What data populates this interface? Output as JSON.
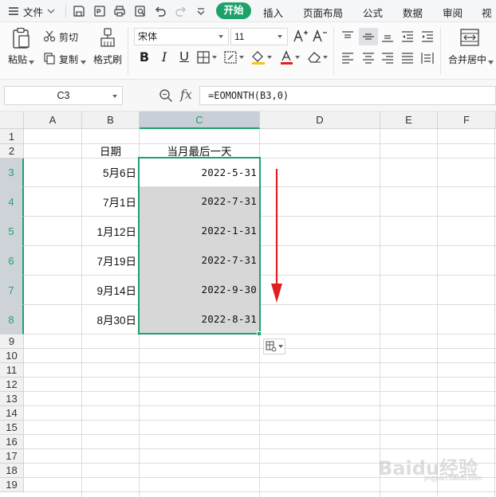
{
  "menubar": {
    "file_label": "文件",
    "tabs": [
      "开始",
      "插入",
      "页面布局",
      "公式",
      "数据",
      "审阅",
      "视图"
    ]
  },
  "ribbon": {
    "paste_label": "粘贴",
    "cut_label": "剪切",
    "copy_label": "复制",
    "format_painter_label": "格式刷",
    "font_name": "宋体",
    "font_size": "11",
    "merge_center_label": "合并居中"
  },
  "formula_bar": {
    "cell_ref": "C3",
    "fx_label": "fx",
    "formula": "=EOMONTH(B3,0)"
  },
  "grid": {
    "columns": [
      "A",
      "B",
      "C",
      "D",
      "E",
      "F"
    ],
    "rows": [
      "1",
      "2",
      "3",
      "4",
      "5",
      "6",
      "7",
      "8",
      "9",
      "10",
      "11",
      "12",
      "13",
      "14",
      "15",
      "16",
      "17",
      "18",
      "19"
    ],
    "header_b2": "日期",
    "header_c2": "当月最后一天",
    "dates": [
      "5月6日",
      "7月1日",
      "1月12日",
      "7月19日",
      "9月14日",
      "8月30日"
    ],
    "month_ends": [
      "2022-5-31",
      "2022-7-31",
      "2022-1-31",
      "2022-7-31",
      "2022-9-30",
      "2022-8-31"
    ]
  },
  "watermark": {
    "text": "Baidu经验",
    "sub": "jingyan.baidu.com"
  },
  "colors": {
    "accent": "#1ea26a",
    "arrow": "#e02020",
    "selection_fill": "#d7d7d7"
  },
  "icons": [
    "menu-icon",
    "save-icon",
    "export-pdf-icon",
    "print-icon",
    "print-preview-icon",
    "undo-icon",
    "redo-icon",
    "paste-icon",
    "cut-icon",
    "copy-icon",
    "format-painter-icon",
    "zoom-icon",
    "paste-options-icon"
  ]
}
